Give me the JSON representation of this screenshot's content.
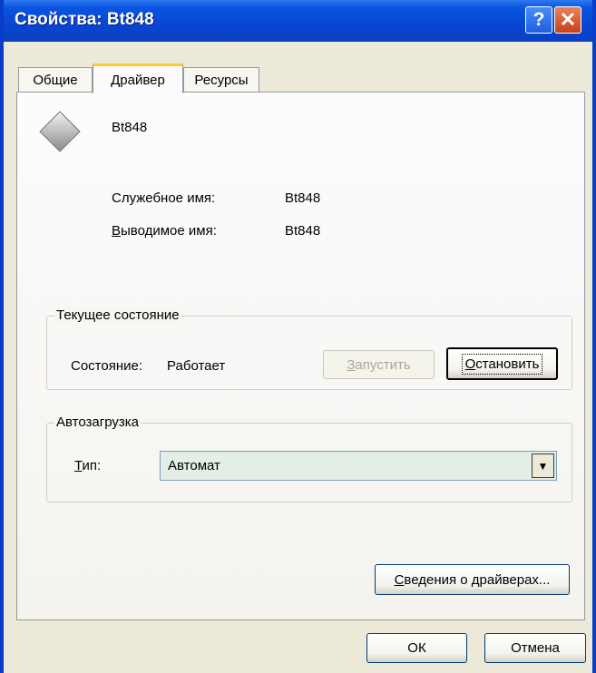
{
  "window": {
    "title": "Свойства: Bt848"
  },
  "tabs": [
    {
      "label": "Общие"
    },
    {
      "label": "Драйвер"
    },
    {
      "label": "Ресурсы"
    }
  ],
  "device": {
    "name": "Bt848",
    "service_name_label": "Служебное имя:",
    "service_name_value": "Bt848",
    "display_name_label_first": "В",
    "display_name_label_rest": "ыводимое имя:",
    "display_name_value": "Bt848"
  },
  "current_state": {
    "group_title": "Текущее состояние",
    "status_label": "Состояние:",
    "status_value": "Работает",
    "start_first": "З",
    "start_rest": "апустить",
    "stop_first": "О",
    "stop_rest": "становить"
  },
  "autostart": {
    "group_title": "Автозагрузка",
    "type_label_first": "Т",
    "type_label_rest": "ип:",
    "type_value": "Автомат"
  },
  "driver_info_first": "С",
  "driver_info_rest": "ведения о драйверах...",
  "ok_label": "ОК",
  "cancel_label": "Отмена"
}
